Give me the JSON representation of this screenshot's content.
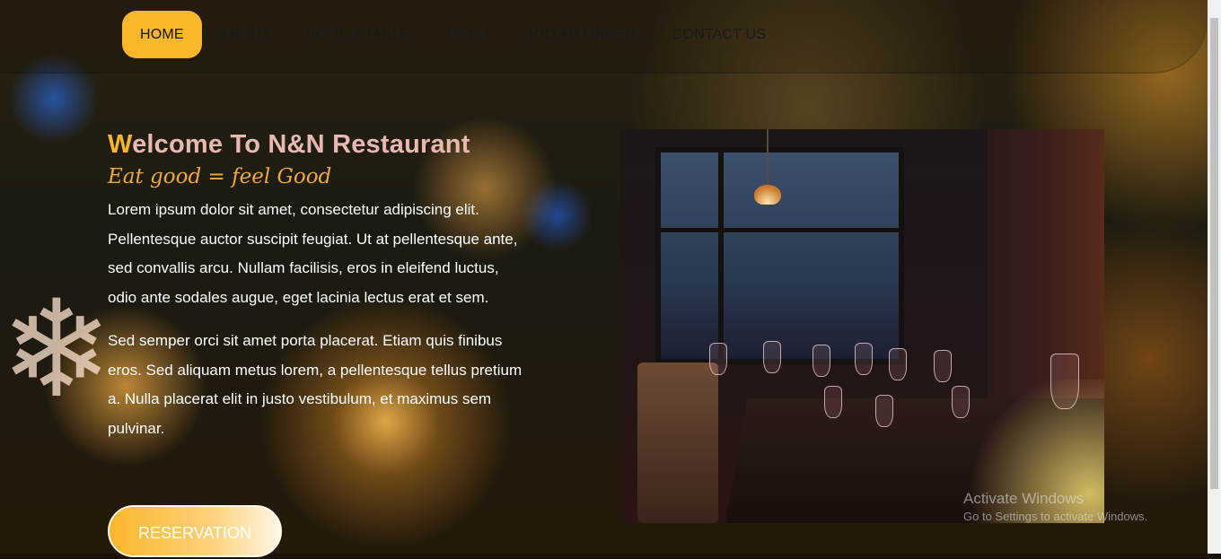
{
  "nav": {
    "items": [
      {
        "label": "HOME",
        "active": true
      },
      {
        "label": "ABOUT"
      },
      {
        "label": "BOOK A TABLE"
      },
      {
        "label": "MENU"
      },
      {
        "label": "ADD AN ORDER"
      },
      {
        "label": "CONTACT US"
      }
    ]
  },
  "hero": {
    "title_first": "W",
    "title_rest": "elcome To N&N Restaurant",
    "tagline": "Eat good = feel Good",
    "paragraph1": "Lorem ipsum dolor sit amet, consectetur adipiscing elit. Pellentesque auctor suscipit feugiat. Ut at pellentesque ante, sed convallis arcu. Nullam facilisis, eros in eleifend luctus, odio ante sodales augue, eget lacinia lectus erat et sem.",
    "paragraph2": "Sed semper orci sit amet porta placerat. Etiam quis finibus eros. Sed aliquam metus lorem, a pellentesque tellus pretium a. Nulla placerat elit in justo vestibulum, et maximus sem pulvinar.",
    "button_label": "RESERVATION"
  },
  "watermark": {
    "line1": "Activate Windows",
    "line2": "Go to Settings to activate Windows."
  },
  "colors": {
    "accent": "#fbb62a",
    "title": "#e9b8b0",
    "tagline": "#f2a93b"
  }
}
